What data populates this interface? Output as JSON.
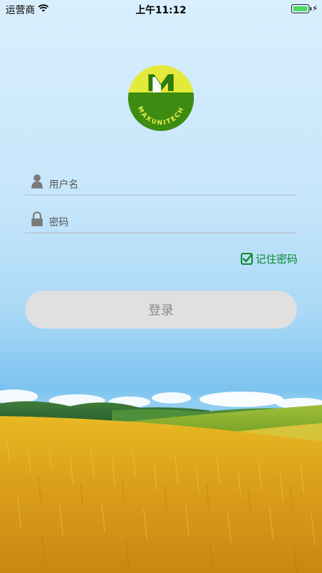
{
  "status_bar": {
    "carrier": "运营商",
    "time": "上午11:12",
    "wifi_icon": "wifi-icon",
    "battery_icon": "battery-icon",
    "charging_icon": "bolt-icon"
  },
  "logo": {
    "brand_text": "MAXUNITECH",
    "icon": "maxunitech-logo"
  },
  "form": {
    "username": {
      "placeholder": "用户名",
      "value": "",
      "icon": "user-icon"
    },
    "password": {
      "placeholder": "密码",
      "value": "",
      "icon": "lock-icon"
    },
    "remember": {
      "label": "记住密码",
      "checked": true,
      "icon": "checkbox-icon"
    },
    "login_label": "登录"
  },
  "colors": {
    "accent_green": "#0a8a2e",
    "logo_yellow": "#e6ea38",
    "logo_green": "#3b8a10",
    "button_bg": "#e0e0e0",
    "button_text": "#8a8a8a"
  }
}
